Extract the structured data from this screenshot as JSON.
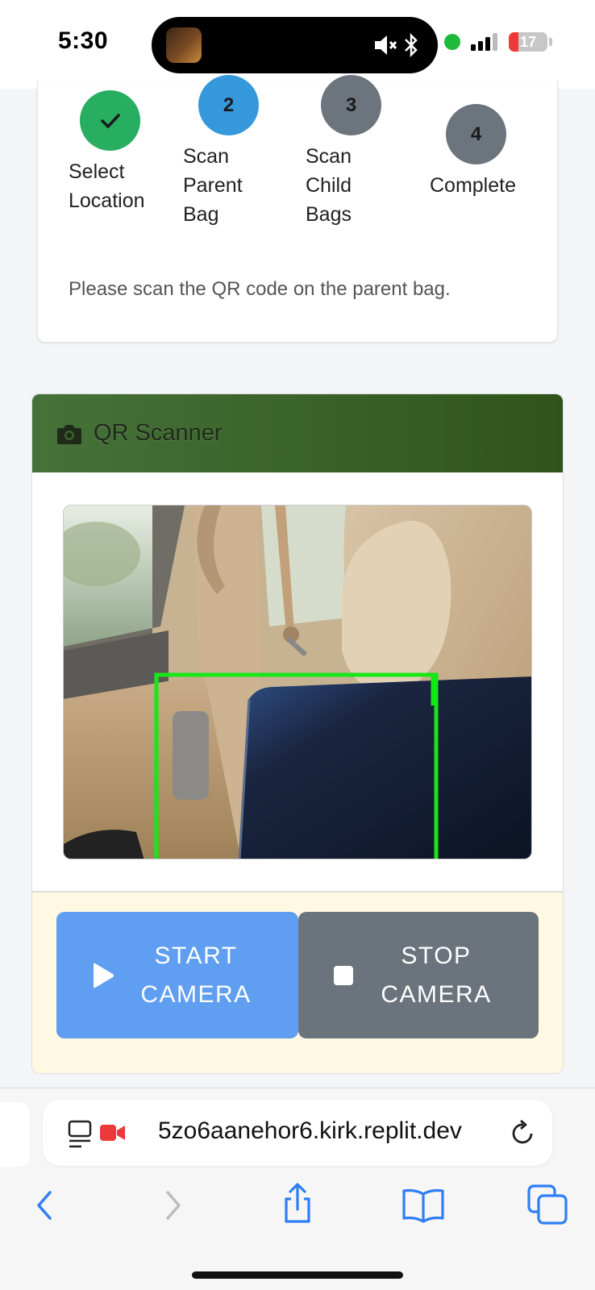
{
  "status_bar": {
    "time": "5:30",
    "battery": "17"
  },
  "progress": {
    "steps": [
      {
        "number": "",
        "label": "Select Location",
        "state": "done",
        "color": "#27ae60"
      },
      {
        "number": "2",
        "label": "Scan Parent Bag",
        "state": "active",
        "color": "#3498db"
      },
      {
        "number": "3",
        "label": "Scan Child Bags",
        "state": "pending",
        "color": "#6c757d"
      },
      {
        "number": "4",
        "label": "Complete",
        "state": "pending",
        "color": "#6c757d"
      }
    ],
    "instruction": "Please scan the QR code on the parent bag."
  },
  "scanner": {
    "title": "QR Scanner",
    "icon": "camera-icon",
    "start_label": "START CAMERA",
    "stop_label": "STOP CAMERA",
    "start_icon": "play-icon",
    "stop_icon": "stop-icon",
    "frame_color": "#19e619"
  },
  "browser": {
    "url": "5zo6aanehor6.kirk.replit.dev",
    "icons": [
      "reader-icon",
      "recording-icon",
      "reload-icon"
    ],
    "nav_icons": [
      "back-icon",
      "forward-icon",
      "share-icon",
      "bookmarks-icon",
      "tabs-icon"
    ]
  }
}
